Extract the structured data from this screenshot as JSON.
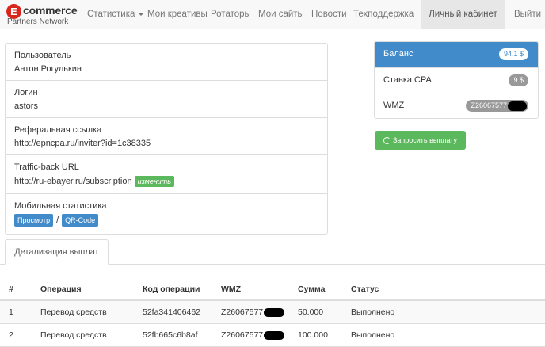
{
  "brand": {
    "letter": "E",
    "word": "commerce",
    "sub": "Partners Network"
  },
  "nav": {
    "items": [
      "Статистика",
      "Мои креативы",
      "Ротаторы",
      "Мои сайты",
      "Новости",
      "Техподдержка",
      "Личный кабинет",
      "Выйти"
    ],
    "active": "Личный кабинет"
  },
  "user": {
    "user_label": "Пользователь",
    "user_value": "Антон Рогулькин",
    "login_label": "Логин",
    "login_value": "astors",
    "ref_label": "Реферальная ссылка",
    "ref_value": "http://epncpa.ru/inviter?id=1c38335",
    "tb_label": "Traffic-back URL",
    "tb_value": "http://ru-ebayer.ru/subscription",
    "tb_button": "изменить",
    "mobile_label": "Мобильная статистика",
    "view_button": "Просмотр",
    "slash": "/",
    "qr_button": "QR-Code"
  },
  "balance": {
    "rows": [
      {
        "label": "Баланс",
        "badge": "94.1 $"
      },
      {
        "label": "Ставка CPA",
        "badge": "9 $"
      },
      {
        "label": "WMZ",
        "badge": "Z26067577"
      }
    ],
    "payout_button": "Запросить выплату"
  },
  "tab": {
    "label": "Детализация выплат"
  },
  "table": {
    "headers": [
      "#",
      "Операция",
      "Код операции",
      "WMZ",
      "Сумма",
      "Статус"
    ],
    "rows": [
      {
        "num": "1",
        "op": "Перевод средств",
        "code": "52fa341406462",
        "wmz": "Z26067577",
        "sum": "50.000",
        "status": "Выполнено"
      },
      {
        "num": "2",
        "op": "Перевод средств",
        "code": "52fb665c6b8af",
        "wmz": "Z26067577",
        "sum": "100.000",
        "status": "Выполнено"
      }
    ]
  },
  "colors": {
    "primary": "#428bca",
    "success": "#5cb85c",
    "brand_red": "#d9261c"
  }
}
